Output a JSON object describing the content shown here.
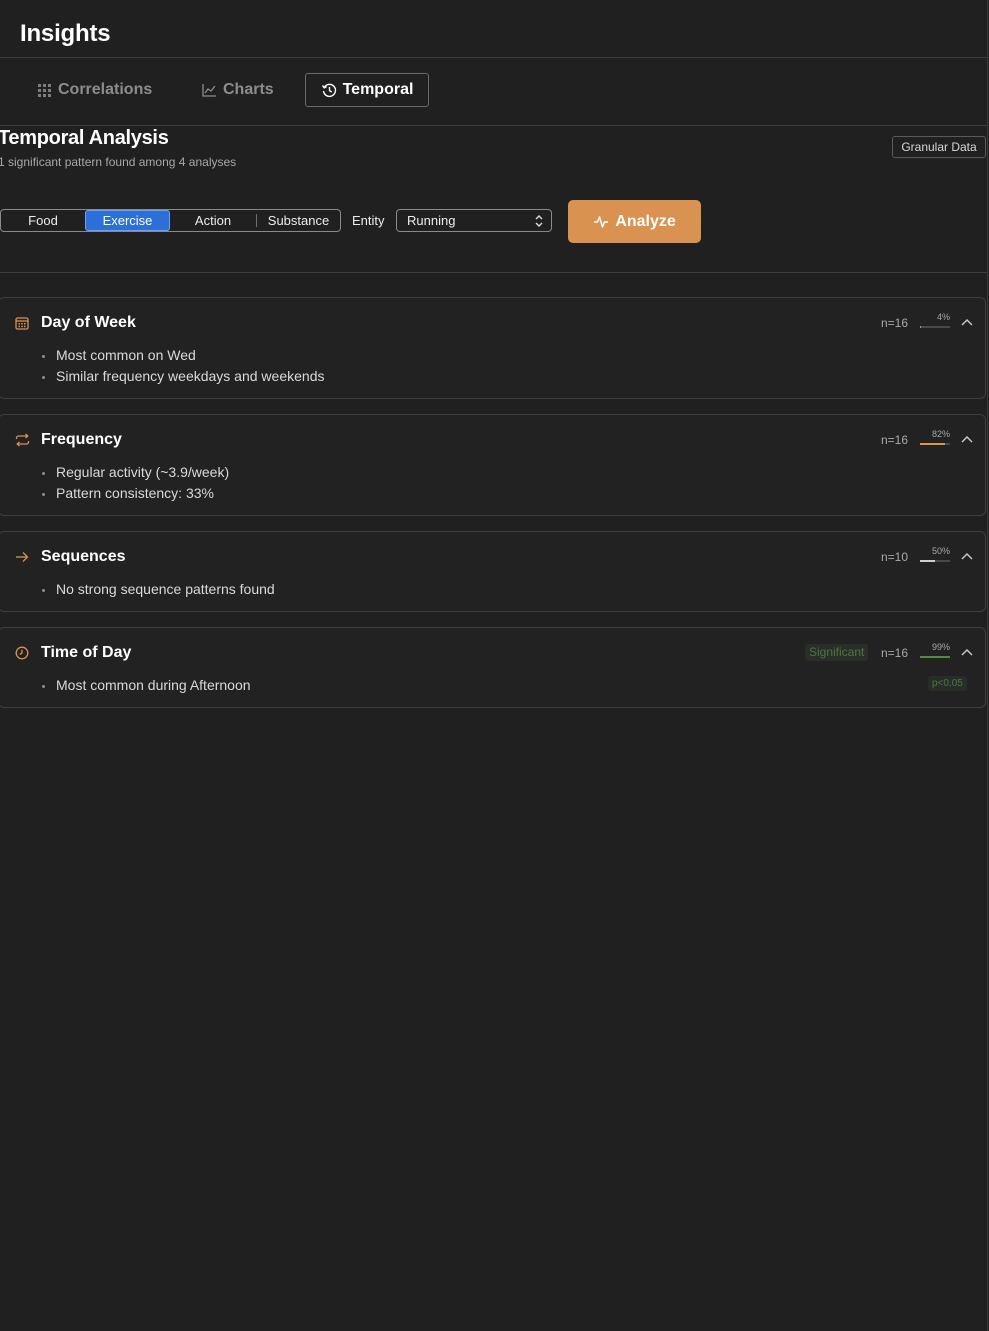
{
  "app": {
    "title": "Insights"
  },
  "tabs": [
    {
      "label": "Correlations",
      "icon": "grid-icon",
      "active": false
    },
    {
      "label": "Charts",
      "icon": "line-chart-icon",
      "active": false
    },
    {
      "label": "Temporal",
      "icon": "history-icon",
      "active": true
    }
  ],
  "section": {
    "title": "Temporal Analysis",
    "subtitle": "1 significant pattern found among 4 analyses",
    "granular_label": "Granular Data"
  },
  "controls": {
    "categories": [
      {
        "label": "Food",
        "active": false
      },
      {
        "label": "Exercise",
        "active": true
      },
      {
        "label": "Action",
        "active": false
      },
      {
        "label": "Substance",
        "active": false
      }
    ],
    "entity_label": "Entity",
    "entity_value": "Running",
    "analyze_label": "Analyze",
    "accent": "#d9924f",
    "selected_color": "#2c6fd8"
  },
  "cards": [
    {
      "title": "Day of Week",
      "icon": "calendar-icon",
      "bullets": [
        "Most common on Wed",
        "Similar frequency weekdays and weekends"
      ],
      "n": "n=16",
      "pct_label": "4%",
      "pct_value": 4,
      "bar_color": "#9a9a9a"
    },
    {
      "title": "Frequency",
      "icon": "repeat-icon",
      "bullets": [
        "Regular activity (~3.9/week)",
        "Pattern consistency: 33%"
      ],
      "n": "n=16",
      "pct_label": "82%",
      "pct_value": 82,
      "bar_color": "#d9924f"
    },
    {
      "title": "Sequences",
      "icon": "arrow-right-icon",
      "bullets": [
        "No strong sequence patterns found"
      ],
      "n": "n=10",
      "pct_label": "50%",
      "pct_value": 50,
      "bar_color": "#cfcfcf"
    },
    {
      "title": "Time of Day",
      "icon": "clock-icon",
      "bullets": [
        "Most common during Afternoon"
      ],
      "n": "n=16",
      "pct_label": "99%",
      "pct_value": 99,
      "bar_color": "#4f8a3f",
      "badge": "Significant",
      "p_value": "p<0.05"
    }
  ]
}
